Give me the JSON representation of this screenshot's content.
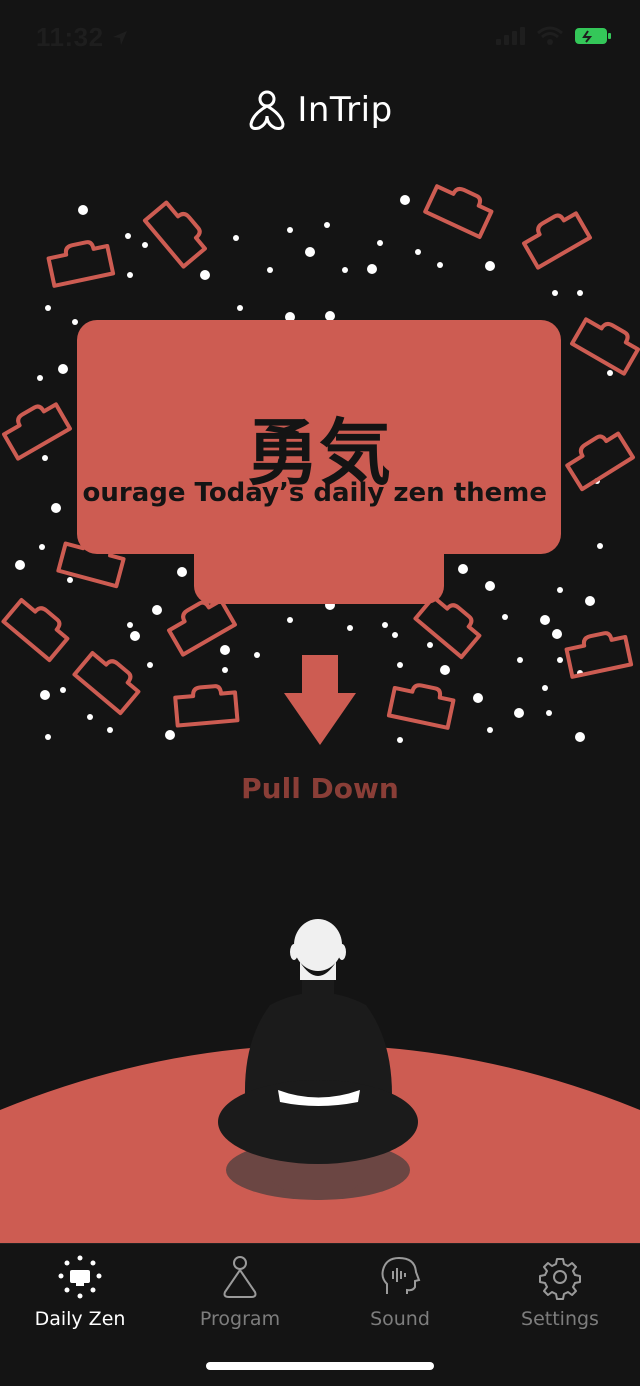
{
  "status": {
    "time": "11:32"
  },
  "header": {
    "app_name": "InTrip"
  },
  "theme_card": {
    "kanji": "勇気",
    "caption": "ourage Today’s daily zen theme"
  },
  "pull": {
    "label": "Pull Down"
  },
  "tabs": [
    {
      "label": "Daily Zen",
      "icon": "daily-zen-icon",
      "active": true
    },
    {
      "label": "Program",
      "icon": "meditation-person-icon",
      "active": false
    },
    {
      "label": "Sound",
      "icon": "head-sound-icon",
      "active": false
    },
    {
      "label": "Settings",
      "icon": "gear-icon",
      "active": false
    }
  ],
  "colors": {
    "background": "#141414",
    "accent": "#cd5c52",
    "pull_text": "#8a3e37",
    "battery": "#34c759"
  }
}
